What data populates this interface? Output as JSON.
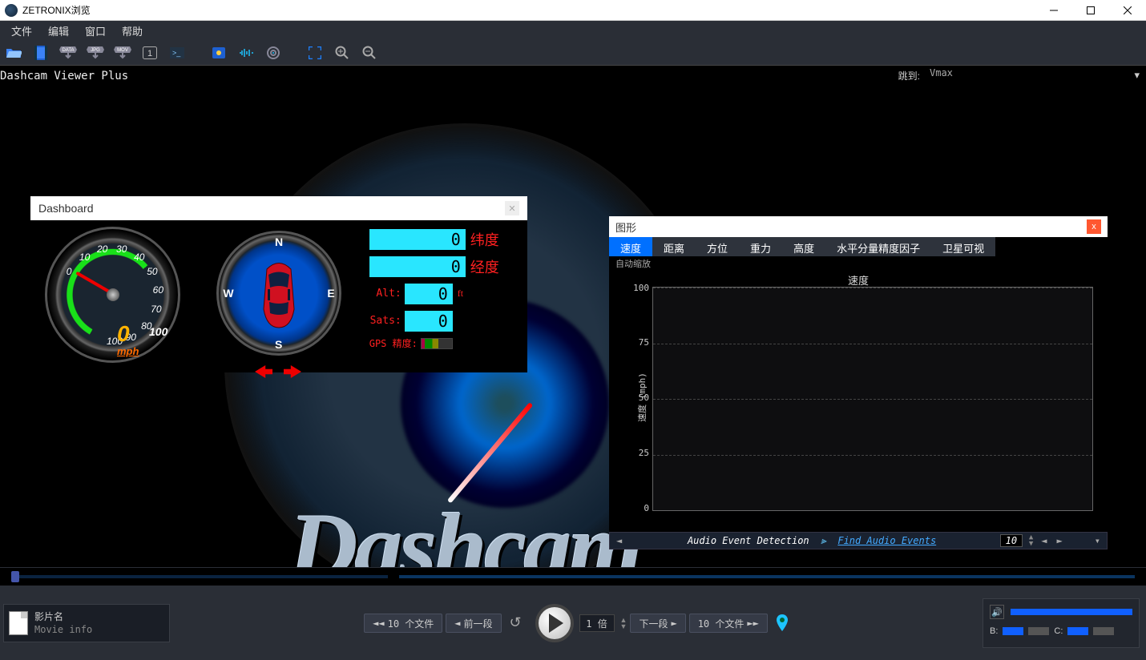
{
  "title": "ZETRONIX浏览",
  "menu": [
    "文件",
    "编辑",
    "窗口",
    "帮助"
  ],
  "toolbar_icons": [
    "folder",
    "film",
    "data",
    "jpg",
    "mov",
    "one",
    "terminal",
    "camera",
    "wave",
    "target",
    "expand",
    "zoom-in",
    "zoom-out"
  ],
  "app_title": "Dashcam Viewer Plus",
  "jump": {
    "label": "跳到:",
    "value": "Vmax"
  },
  "logo": "Dashcam",
  "dashboard": {
    "title": "Dashboard",
    "gauge": {
      "ticks": [
        "0",
        "10",
        "20",
        "30",
        "40",
        "50",
        "60",
        "70",
        "80",
        "90",
        "100"
      ],
      "value": "0",
      "unit": "mph",
      "max": "100"
    },
    "compass": {
      "dirs": [
        "N",
        "E",
        "S",
        "W"
      ]
    },
    "readouts": {
      "lat_label": "纬度",
      "lon_label": "经度",
      "lat": "0",
      "lon": "0",
      "alt_label": "Alt:",
      "alt": "0",
      "alt_unit": "ft",
      "sats_label": "Sats:",
      "sats": "0",
      "gps_label": "GPS 精度:"
    }
  },
  "graph": {
    "title": "图形",
    "tabs": [
      "速度",
      "距离",
      "方位",
      "重力",
      "高度",
      "水平分量精度因子",
      "卫星可视"
    ],
    "active_tab": 0,
    "autoscale": "自动缩放",
    "chart_title": "速度",
    "ylabel": "速度 (mph)",
    "footer": {
      "label": "Audio Event Detection",
      "link": "Find Audio Events",
      "num": "10"
    }
  },
  "chart_data": {
    "type": "line",
    "title": "速度",
    "xlabel": "",
    "ylabel": "速度 (mph)",
    "ylim": [
      0,
      100
    ],
    "yticks": [
      0,
      25,
      50,
      75,
      100
    ],
    "series": [
      {
        "name": "速度",
        "values": []
      }
    ]
  },
  "movie": {
    "name": "影片名",
    "info": "Movie info"
  },
  "transport": {
    "back10": "10 个文件",
    "prev": "前一段",
    "rate": "1 倍",
    "next": "下一段",
    "fwd10": "10 个文件"
  },
  "vol": {
    "b": "B:",
    "c": "C:"
  }
}
